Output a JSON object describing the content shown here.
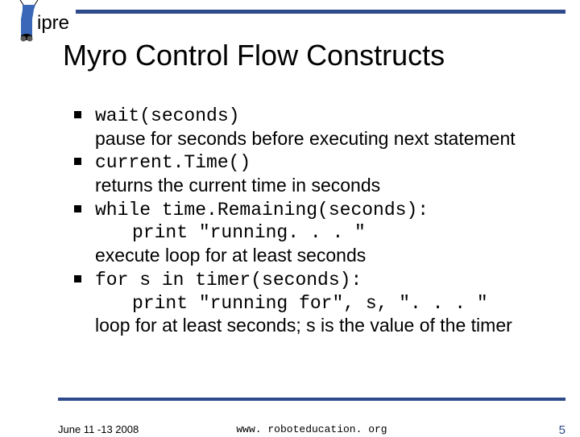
{
  "logo_text": "ipre",
  "title": "Myro Control Flow Constructs",
  "items": [
    {
      "code": "wait(seconds)",
      "desc": "pause for seconds before executing next statement"
    },
    {
      "code": "current.Time()",
      "desc": "returns the current time in seconds"
    },
    {
      "code": "while time.Remaining(seconds):",
      "code2": "print \"running. . . \"",
      "desc": "execute loop for at least seconds"
    },
    {
      "code": "for s in timer(seconds):",
      "code2": "print \"running for\", s, \". . . \"",
      "desc": "loop for at least seconds; s is the value of the timer"
    }
  ],
  "footer": {
    "date": "June 11 -13 2008",
    "url": "www. roboteducation. org",
    "page": "5"
  }
}
